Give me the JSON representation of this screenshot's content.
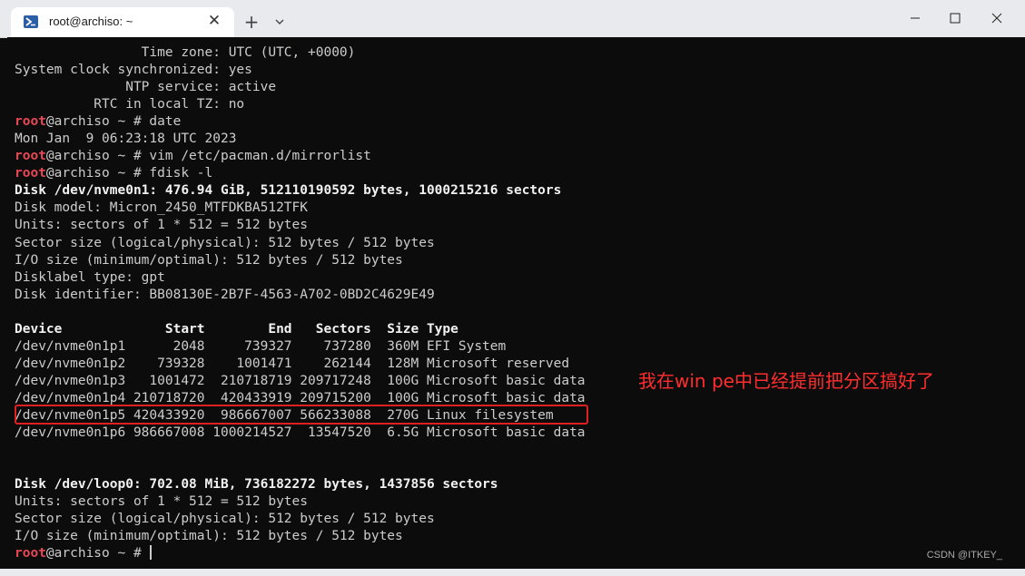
{
  "window": {
    "tab_title": "root@archiso: ~",
    "tab_close": "✕",
    "new_tab": "+",
    "icons": [
      "powershell-icon",
      "close-icon",
      "add-icon",
      "chevron-down-icon",
      "minimize-icon",
      "maximize-icon",
      "close-window-icon"
    ]
  },
  "terminal": {
    "lines": [
      {
        "type": "plain",
        "text": "Time zone: UTC (UTC, +0000)",
        "pad": "                "
      },
      {
        "type": "plain",
        "text": "System clock synchronized: yes",
        "pad": ""
      },
      {
        "type": "plain",
        "text": "NTP service: active",
        "pad": "              "
      },
      {
        "type": "plain",
        "text": "RTC in local TZ: no",
        "pad": "          "
      },
      {
        "type": "prompt",
        "user": "root",
        "rest": "@archiso ~ # date"
      },
      {
        "type": "plain",
        "text": "Mon Jan  9 06:23:18 UTC 2023",
        "pad": ""
      },
      {
        "type": "prompt",
        "user": "root",
        "rest": "@archiso ~ # vim /etc/pacman.d/mirrorlist"
      },
      {
        "type": "prompt",
        "user": "root",
        "rest": "@archiso ~ # fdisk -l"
      },
      {
        "type": "bold",
        "text": "Disk /dev/nvme0n1: 476.94 GiB, 512110190592 bytes, 1000215216 sectors"
      },
      {
        "type": "plain",
        "text": "Disk model: Micron_2450_MTFDKBA512TFK",
        "pad": ""
      },
      {
        "type": "plain",
        "text": "Units: sectors of 1 * 512 = 512 bytes",
        "pad": ""
      },
      {
        "type": "plain",
        "text": "Sector size (logical/physical): 512 bytes / 512 bytes",
        "pad": ""
      },
      {
        "type": "plain",
        "text": "I/O size (minimum/optimal): 512 bytes / 512 bytes",
        "pad": ""
      },
      {
        "type": "plain",
        "text": "Disklabel type: gpt",
        "pad": ""
      },
      {
        "type": "plain",
        "text": "Disk identifier: BB08130E-2B7F-4563-A702-0BD2C4629E49",
        "pad": ""
      },
      {
        "type": "plain",
        "text": "",
        "pad": ""
      },
      {
        "type": "bold",
        "text": "Device             Start        End   Sectors  Size Type"
      },
      {
        "type": "plain",
        "text": "/dev/nvme0n1p1      2048     739327    737280  360M EFI System",
        "pad": ""
      },
      {
        "type": "plain",
        "text": "/dev/nvme0n1p2    739328    1001471    262144  128M Microsoft reserved",
        "pad": ""
      },
      {
        "type": "plain",
        "text": "/dev/nvme0n1p3   1001472  210718719 209717248  100G Microsoft basic data",
        "pad": ""
      },
      {
        "type": "plain",
        "text": "/dev/nvme0n1p4 210718720  420433919 209715200  100G Microsoft basic data",
        "pad": ""
      },
      {
        "type": "plain",
        "text": "/dev/nvme0n1p5 420433920  986667007 566233088  270G Linux filesystem",
        "pad": ""
      },
      {
        "type": "plain",
        "text": "/dev/nvme0n1p6 986667008 1000214527  13547520  6.5G Microsoft basic data",
        "pad": ""
      },
      {
        "type": "plain",
        "text": "",
        "pad": ""
      },
      {
        "type": "plain",
        "text": "",
        "pad": ""
      },
      {
        "type": "bold",
        "text": "Disk /dev/loop0: 702.08 MiB, 736182272 bytes, 1437856 sectors"
      },
      {
        "type": "plain",
        "text": "Units: sectors of 1 * 512 = 512 bytes",
        "pad": ""
      },
      {
        "type": "plain",
        "text": "Sector size (logical/physical): 512 bytes / 512 bytes",
        "pad": ""
      },
      {
        "type": "plain",
        "text": "I/O size (minimum/optimal): 512 bytes / 512 bytes",
        "pad": ""
      },
      {
        "type": "cursor",
        "user": "root",
        "rest": "@archiso ~ # "
      }
    ]
  },
  "annotation": "我在win pe中已经提前把分区搞好了",
  "watermark": "CSDN @ITKEY_",
  "colors": {
    "terminal_bg": "#0c0c0c",
    "text": "#cccccc",
    "prompt_user": "#e74856",
    "annotation": "#ff2d2d",
    "highlight_box": "#e02020"
  }
}
